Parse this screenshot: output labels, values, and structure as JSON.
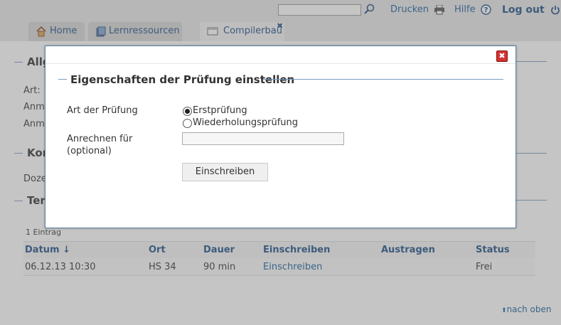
{
  "header": {
    "search": {
      "value": "",
      "placeholder": ""
    },
    "links": {
      "print": "Drucken",
      "help": "Hilfe",
      "logout": "Log out"
    },
    "icons": {
      "search": "search-icon",
      "print": "printer-icon",
      "help": "help-icon",
      "logout": "power-icon"
    }
  },
  "tabs": [
    {
      "label": "Home",
      "icon": "home-icon"
    },
    {
      "label": "Lernressourcen",
      "icon": "books-icon"
    },
    {
      "label": "Compilerbau",
      "icon": "window-icon",
      "closable": true,
      "active": true
    }
  ],
  "background": {
    "sections": [
      "Allg",
      "Kor",
      "Ter"
    ],
    "labels": [
      "Art:",
      "Anme",
      "Anme",
      "Doze"
    ],
    "entry_count": "1 Eintrag",
    "table": {
      "headers": [
        "Datum ↓",
        "Ort",
        "Dauer",
        "Einschreiben",
        "Austragen",
        "Status"
      ],
      "rows": [
        [
          "06.12.13 10:30",
          "HS 34",
          "90 min",
          "Einschreiben",
          "",
          "Frei"
        ]
      ]
    },
    "back_to_top": "nach oben"
  },
  "modal": {
    "title": "Eigenschaften der Prüfung einstellen",
    "close_symbol": "✖",
    "exam_type_label": "Art der Prüfung",
    "options": [
      {
        "label": "Erstprüfung",
        "checked": true
      },
      {
        "label": "Wiederholungsprüfung",
        "checked": false
      }
    ],
    "credit_label_line1": "Anrechnen für",
    "credit_label_line2": "(optional)",
    "credit_value": "",
    "submit_label": "Einschreiben"
  },
  "colors": {
    "link": "#1a5d9a",
    "rule": "#7a9cbe",
    "close": "#d23232"
  }
}
